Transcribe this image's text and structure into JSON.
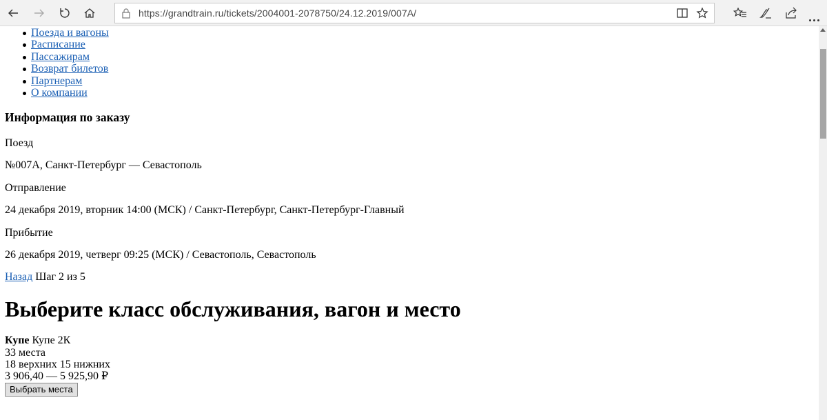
{
  "browser": {
    "url": "https://grandtrain.ru/tickets/2004001-2078750/24.12.2019/007A/"
  },
  "menu": [
    {
      "label": "Поезда и вагоны"
    },
    {
      "label": "Расписание"
    },
    {
      "label": "Пассажирам"
    },
    {
      "label": "Возврат билетов"
    },
    {
      "label": "Партнерам"
    },
    {
      "label": "О компании"
    }
  ],
  "order": {
    "heading": "Информация по заказу",
    "train_label": "Поезд",
    "train_value": "№007А, Санкт-Петербург — Севастополь",
    "departure_label": "Отправление",
    "departure_value": "24 декабря 2019, вторник 14:00 (МСК) / Санкт-Петербург, Санкт-Петербург-Главный",
    "arrival_label": "Прибытие",
    "arrival_value": "26 декабря 2019, четверг 09:25 (МСК) / Севастополь, Севастополь"
  },
  "steps": {
    "back_label": "Назад",
    "step_text": "Шаг 2 из 5"
  },
  "selection": {
    "title": "Выберите класс обслуживания, вагон и место",
    "class_name": "Купе",
    "class_code": "Купе 2К",
    "seats": "33 места",
    "seat_breakdown": "18 верхних 15 нижних",
    "price": "3 906,40 — 5 925,90 ₽",
    "button_label": "Выбрать места"
  },
  "colors": {
    "link": "#1a5fb4",
    "chrome_bg": "#f2f2f2"
  }
}
